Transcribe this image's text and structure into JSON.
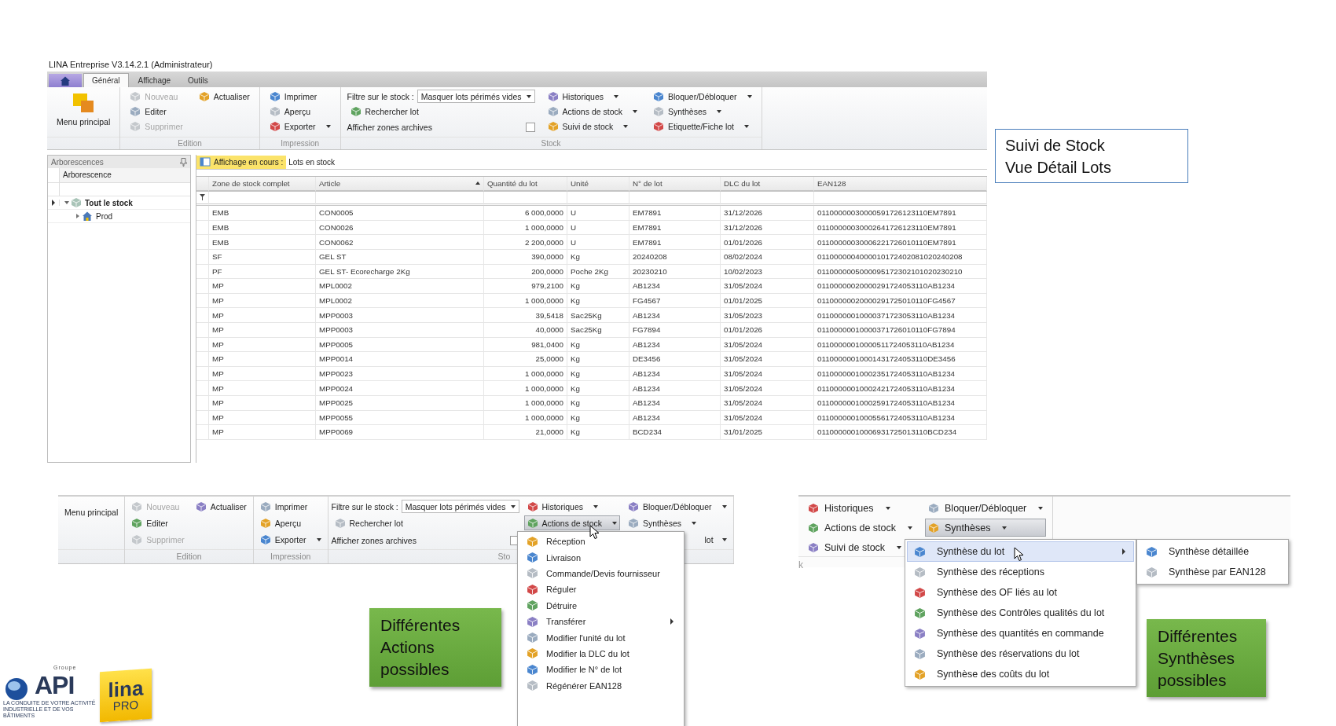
{
  "main_window": {
    "title": "LINA Entreprise V3.14.2.1 (Administrateur)",
    "tabs": [
      {
        "kind": "home",
        "selected": false
      },
      {
        "kind": "text",
        "label": "Général",
        "selected": true
      },
      {
        "kind": "text",
        "label": "Affichage",
        "selected": false
      },
      {
        "kind": "text",
        "label": "Outils",
        "selected": false
      }
    ],
    "ribbon": {
      "groups": [
        {
          "columns": [
            [
              {
                "kind": "large",
                "label": "Menu principal"
              }
            ]
          ]
        },
        {
          "label": "Edition",
          "columns": [
            [
              {
                "kind": "small",
                "label": "Nouveau",
                "disabled": true,
                "dropdown": false
              },
              {
                "kind": "small",
                "label": "Editer",
                "disabled": false,
                "dropdown": false
              },
              {
                "kind": "small",
                "label": "Supprimer",
                "disabled": true,
                "dropdown": false
              }
            ],
            [
              {
                "kind": "small",
                "label": "Actualiser",
                "disabled": false,
                "dropdown": false
              }
            ]
          ]
        },
        {
          "label": "Impression",
          "columns": [
            [
              {
                "kind": "small",
                "label": "Imprimer",
                "disabled": false,
                "dropdown": false
              },
              {
                "kind": "small",
                "label": "Aperçu",
                "disabled": false,
                "dropdown": false
              },
              {
                "kind": "small",
                "label": "Exporter",
                "disabled": false,
                "dropdown": true
              }
            ]
          ]
        },
        {
          "label": "Stock",
          "columns": [
            [
              {
                "kind": "combo",
                "label": "Filtre sur le stock :",
                "value": "Masquer lots périmés vides"
              },
              {
                "kind": "small",
                "label": "Rechercher lot",
                "disabled": false,
                "dropdown": false
              },
              {
                "kind": "check",
                "label": "Afficher zones archives",
                "checked": false
              }
            ],
            [
              {
                "kind": "small",
                "label": "Historiques",
                "disabled": false,
                "dropdown": true
              },
              {
                "kind": "small",
                "label": "Actions de stock",
                "disabled": false,
                "dropdown": true
              },
              {
                "kind": "small",
                "label": "Suivi de stock",
                "disabled": false,
                "dropdown": true
              }
            ],
            [
              {
                "kind": "small",
                "label": "Bloquer/Débloquer",
                "disabled": false,
                "dropdown": true
              },
              {
                "kind": "small",
                "label": "Synthèses",
                "disabled": false,
                "dropdown": true
              },
              {
                "kind": "small",
                "label": "Etiquette/Fiche lot",
                "disabled": false,
                "dropdown": true
              }
            ]
          ]
        }
      ]
    },
    "tree_panel": {
      "title": "Arborescences",
      "column": "Arborescence",
      "items": [
        {
          "label": "Tout le stock",
          "selected": true,
          "expanded": true,
          "children": [
            {
              "label": "Prod",
              "selected": false,
              "expanded": false
            }
          ]
        }
      ]
    },
    "view_label": "Affichage en cours :",
    "view_name": "Lots en stock",
    "table": {
      "columns": [
        {
          "label": "Zone de stock complet"
        },
        {
          "label": "Article",
          "sorted": true
        },
        {
          "label": "Quantité du lot"
        },
        {
          "label": "Unité"
        },
        {
          "label": "N° de lot"
        },
        {
          "label": "DLC du lot"
        },
        {
          "label": "EAN128"
        }
      ],
      "rows": [
        [
          "EMB",
          "CON0005",
          "6 000,0000",
          "U",
          "EM7891",
          "31/12/2026",
          "01100000030000591726123110EM7891"
        ],
        [
          "EMB",
          "CON0026",
          "1 000,0000",
          "U",
          "EM7891",
          "31/12/2026",
          "01100000030002641726123110EM7891"
        ],
        [
          "EMB",
          "CON0062",
          "2 200,0000",
          "U",
          "EM7891",
          "01/01/2026",
          "01100000030006221726010110EM7891"
        ],
        [
          "SF",
          "GEL ST",
          "390,0000",
          "Kg",
          "20240208",
          "08/02/2024",
          "0110000004000010172402081020240208"
        ],
        [
          "PF",
          "GEL ST- Ecorecharge 2Kg",
          "200,0000",
          "Poche 2Kg",
          "20230210",
          "10/02/2023",
          "0110000005000095172302101020230210"
        ],
        [
          "MP",
          "MPL0002",
          "979,2100",
          "Kg",
          "AB1234",
          "31/05/2024",
          "01100000020000291724053110AB1234"
        ],
        [
          "MP",
          "MPL0002",
          "1 000,0000",
          "Kg",
          "FG4567",
          "01/01/2025",
          "01100000020000291725010110FG4567"
        ],
        [
          "MP",
          "MPP0003",
          "39,5418",
          "Sac25Kg",
          "AB1234",
          "31/05/2023",
          "01100000010000371723053110AB1234"
        ],
        [
          "MP",
          "MPP0003",
          "40,0000",
          "Sac25Kg",
          "FG7894",
          "01/01/2026",
          "01100000010000371726010110FG7894"
        ],
        [
          "MP",
          "MPP0005",
          "981,0400",
          "Kg",
          "AB1234",
          "31/05/2024",
          "01100000010000511724053110AB1234"
        ],
        [
          "MP",
          "MPP0014",
          "25,0000",
          "Kg",
          "DE3456",
          "31/05/2024",
          "01100000010001431724053110DE3456"
        ],
        [
          "MP",
          "MPP0023",
          "1 000,0000",
          "Kg",
          "AB1234",
          "31/05/2024",
          "01100000010002351724053110AB1234"
        ],
        [
          "MP",
          "MPP0024",
          "1 000,0000",
          "Kg",
          "AB1234",
          "31/05/2024",
          "01100000010002421724053110AB1234"
        ],
        [
          "MP",
          "MPP0025",
          "1 000,0000",
          "Kg",
          "AB1234",
          "31/05/2024",
          "01100000010002591724053110AB1234"
        ],
        [
          "MP",
          "MPP0055",
          "1 000,0000",
          "Kg",
          "AB1234",
          "31/05/2024",
          "01100000010005561724053110AB1234"
        ],
        [
          "MP",
          "MPP0069",
          "21,0000",
          "Kg",
          "BCD234",
          "31/01/2025",
          "01100000010006931725013110BCD234"
        ]
      ]
    }
  },
  "caption": [
    "Suivi de Stock",
    "Vue Détail Lots"
  ],
  "ribbon_actions": {
    "groups": [
      {
        "columns": [
          [
            {
              "kind": "large",
              "label": "Menu principal"
            }
          ]
        ]
      },
      {
        "label": "Edition",
        "columns": [
          [
            {
              "kind": "small",
              "label": "Nouveau",
              "disabled": true,
              "dropdown": false,
              "pressed": false
            },
            {
              "kind": "small",
              "label": "Editer",
              "disabled": false,
              "dropdown": false,
              "pressed": false
            },
            {
              "kind": "small",
              "label": "Supprimer",
              "disabled": true,
              "dropdown": false,
              "pressed": false
            }
          ],
          [
            {
              "kind": "small",
              "label": "Actualiser",
              "disabled": false,
              "dropdown": false,
              "pressed": false
            }
          ]
        ]
      },
      {
        "label": "Impression",
        "columns": [
          [
            {
              "kind": "small",
              "label": "Imprimer",
              "disabled": false,
              "dropdown": false,
              "pressed": false
            },
            {
              "kind": "small",
              "label": "Aperçu",
              "disabled": false,
              "dropdown": false,
              "pressed": false
            },
            {
              "kind": "small",
              "label": "Exporter",
              "disabled": false,
              "dropdown": true,
              "pressed": false
            }
          ]
        ]
      },
      {
        "label": "Sto",
        "columns": [
          [
            {
              "kind": "combo",
              "label": "Filtre sur le stock :",
              "value": "Masquer lots périmés vides"
            },
            {
              "kind": "small",
              "label": "Rechercher lot",
              "disabled": false,
              "dropdown": false,
              "pressed": false
            },
            {
              "kind": "check",
              "label": "Afficher zones archives",
              "checked": false
            }
          ],
          [
            {
              "kind": "small",
              "label": "Historiques",
              "disabled": false,
              "dropdown": true,
              "pressed": false
            },
            {
              "kind": "small",
              "label": "Actions de stock",
              "disabled": false,
              "dropdown": true,
              "pressed": true
            },
            {
              "kind": "gap"
            }
          ],
          [
            {
              "kind": "small",
              "label": "Bloquer/Débloquer",
              "disabled": false,
              "dropdown": true,
              "pressed": false
            },
            {
              "kind": "small",
              "label": "Synthèses",
              "disabled": false,
              "dropdown": true,
              "pressed": false
            },
            {
              "kind": "partial",
              "label": "lot",
              "dropdown": true
            }
          ]
        ]
      }
    ]
  },
  "actions_menu": [
    {
      "label": "Réception",
      "selected": false
    },
    {
      "label": "Livraison",
      "selected": false
    },
    {
      "label": "Commande/Devis fournisseur",
      "selected": false
    },
    {
      "label": "Réguler",
      "selected": false
    },
    {
      "label": "Détruire",
      "selected": false
    },
    {
      "label": "Transférer",
      "selected": false,
      "submenu": true
    },
    {
      "label": "Modifier l'unité du lot",
      "selected": false
    },
    {
      "label": "Modifier la DLC du lot",
      "selected": false
    },
    {
      "label": "Modifier le N° de lot",
      "selected": false
    },
    {
      "label": "Régénérer EAN128",
      "selected": false
    }
  ],
  "callout_actions": [
    "Différentes",
    "Actions",
    "possibles"
  ],
  "ribbon_syntheses": {
    "groups": [
      {
        "label": "k",
        "columns": [
          [
            {
              "kind": "small",
              "label": "Historiques",
              "disabled": false,
              "dropdown": true,
              "pressed": false
            },
            {
              "kind": "small",
              "label": "Actions de stock",
              "disabled": false,
              "dropdown": true,
              "pressed": false
            },
            {
              "kind": "small",
              "label": "Suivi de stock",
              "disabled": false,
              "dropdown": true,
              "pressed": false
            }
          ],
          [
            {
              "kind": "small",
              "label": "Bloquer/Débloquer",
              "disabled": false,
              "dropdown": true,
              "pressed": false
            },
            {
              "kind": "small",
              "label": "Synthèses",
              "disabled": false,
              "dropdown": true,
              "pressed": true
            }
          ]
        ]
      }
    ]
  },
  "syntheses_menu": [
    {
      "label": "Synthèse du lot",
      "selected": true,
      "submenu": true
    },
    {
      "label": "Synthèse des réceptions",
      "selected": false
    },
    {
      "label": "Synthèse des OF liés au lot",
      "selected": false
    },
    {
      "label": "Synthèse des Contrôles qualités du lot",
      "selected": false
    },
    {
      "label": "Synthèse des quantités en commande",
      "selected": false
    },
    {
      "label": "Synthèse des réservations du lot",
      "selected": false
    },
    {
      "label": "Synthèse des coûts du lot",
      "selected": false
    }
  ],
  "syntheses_submenu": [
    {
      "label": "Synthèse détaillée",
      "selected": false
    },
    {
      "label": "Synthèse par EAN128",
      "selected": false
    }
  ],
  "callout_syntheses": [
    "Différentes",
    "Synthèses",
    "possibles"
  ],
  "logos": {
    "group_label": "Groupe",
    "brand": "API",
    "tagline": "LA CONDUITE DE VOTRE ACTIVITÉ INDUSTRIELLE ET DE VOS BÂTIMENTS",
    "product": "lina",
    "edition": "PRO"
  }
}
